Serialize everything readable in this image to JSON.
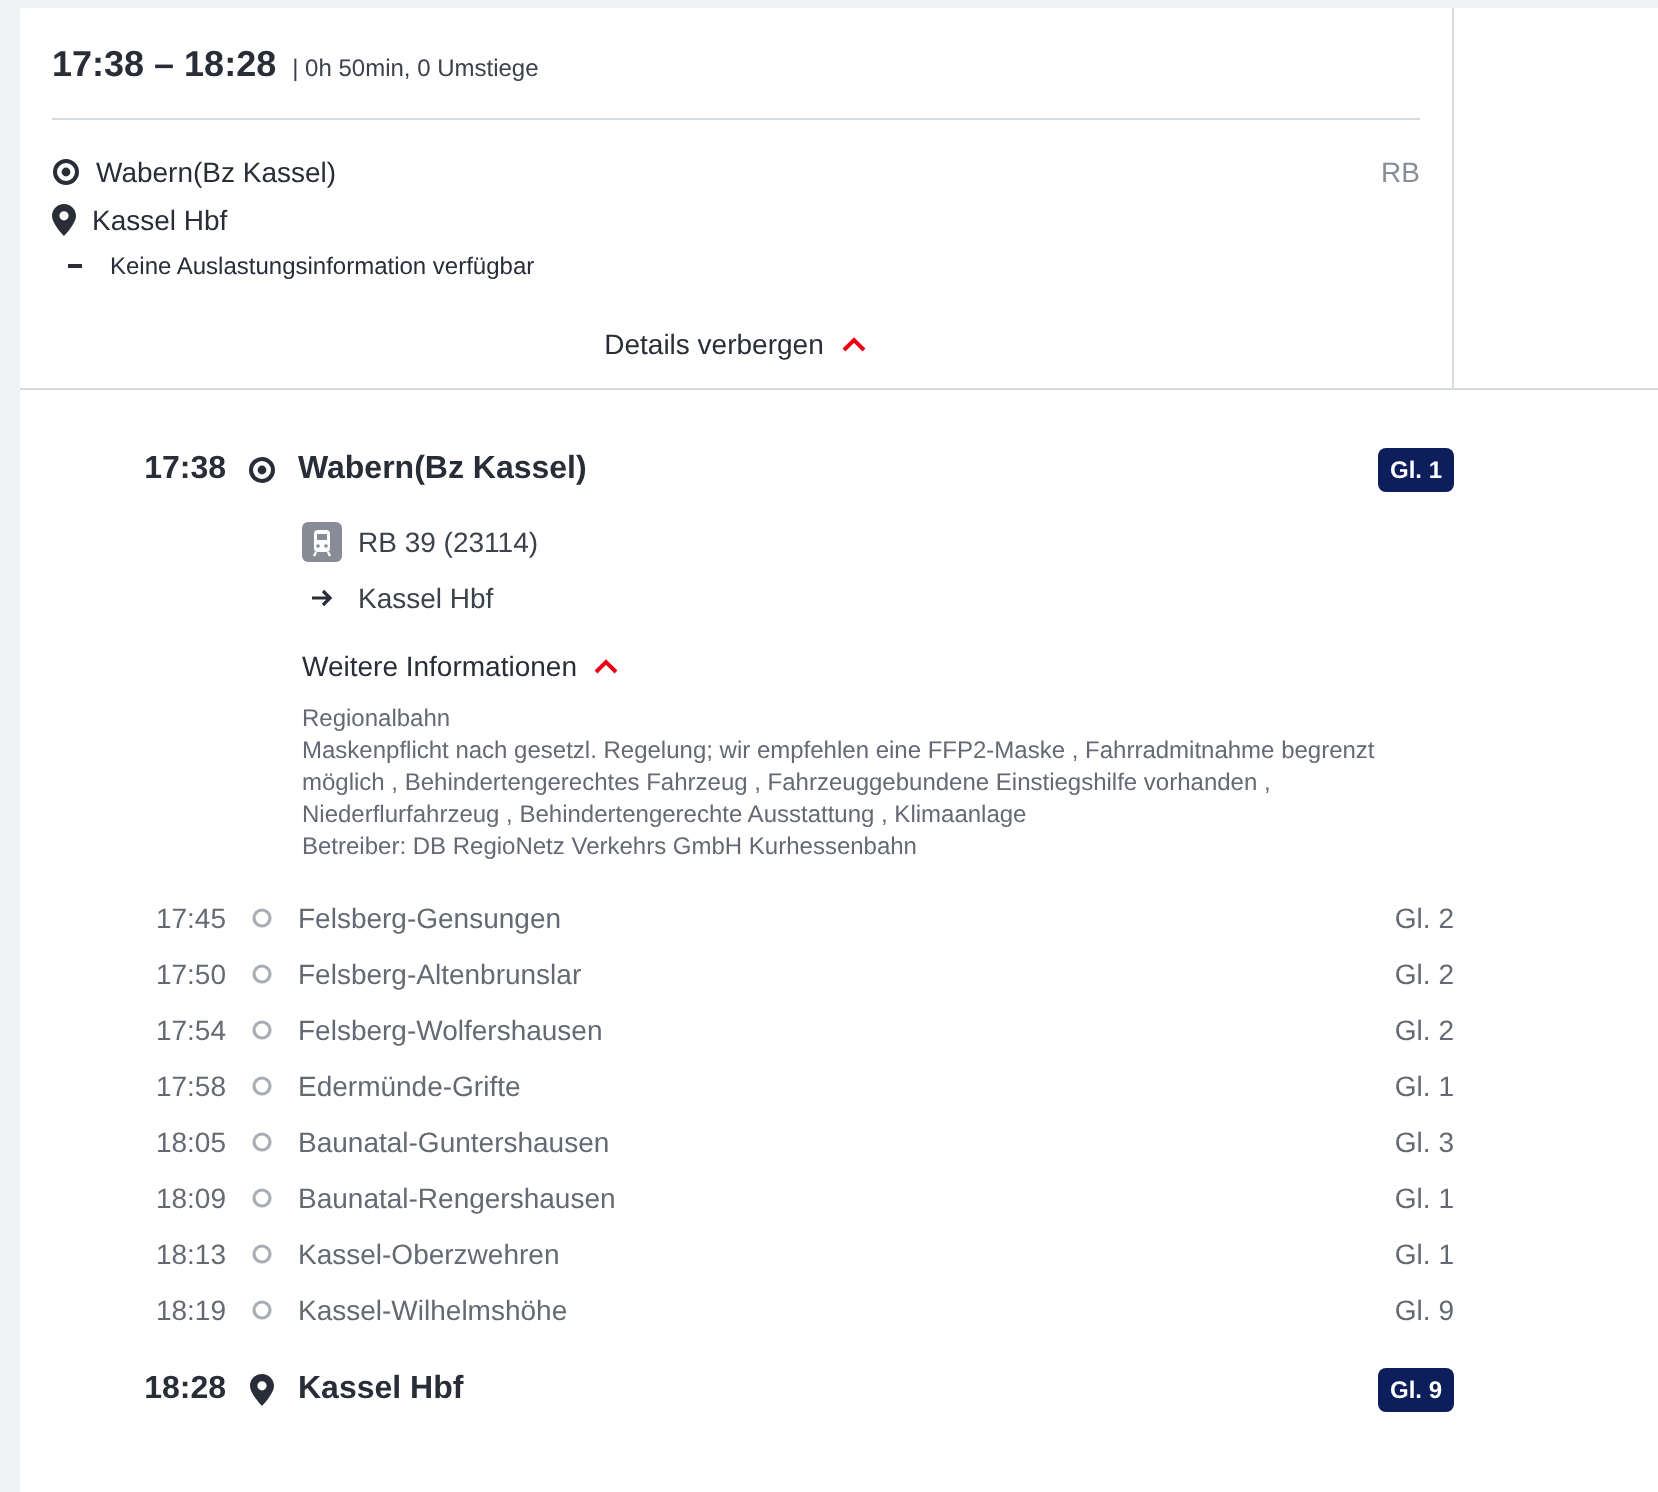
{
  "summary": {
    "time_range": "17:38 – 18:28",
    "duration": "| 0h 50min, 0 Umstiege",
    "origin": "Wabern(Bz Kassel)",
    "destination": "Kassel Hbf",
    "product": "RB",
    "occupancy": "Keine Auslastungsinformation verfügbar",
    "toggle": {
      "label": "Details verbergen",
      "expanded": true
    }
  },
  "journey": {
    "departure": {
      "time": "17:38",
      "station": "Wabern(Bz Kassel)",
      "platform": "Gl. 1"
    },
    "train": "RB 39 (23114)",
    "direction": "Kassel Hbf",
    "more_info": {
      "label": "Weitere Informationen",
      "expanded": true
    },
    "info_lines": [
      "Regionalbahn",
      "Maskenpflicht nach gesetzl. Regelung; wir empfehlen eine FFP2-Maske , Fahrradmitnahme begrenzt möglich , Behindertengerechtes Fahrzeug , Fahrzeuggebundene Einstiegshilfe vorhanden , Niederflurfahrzeug , Behindertengerechte Ausstattung , Klimaanlage",
      "Betreiber: DB RegioNetz Verkehrs GmbH Kurhessenbahn"
    ],
    "stops": [
      {
        "time": "17:45",
        "station": "Felsberg-Gensungen",
        "platform": "Gl. 2"
      },
      {
        "time": "17:50",
        "station": "Felsberg-Altenbrunslar",
        "platform": "Gl. 2"
      },
      {
        "time": "17:54",
        "station": "Felsberg-Wolfershausen",
        "platform": "Gl. 2"
      },
      {
        "time": "17:58",
        "station": "Edermünde-Grifte",
        "platform": "Gl. 1"
      },
      {
        "time": "18:05",
        "station": "Baunatal-Guntershausen",
        "platform": "Gl. 3"
      },
      {
        "time": "18:09",
        "station": "Baunatal-Rengershausen",
        "platform": "Gl. 1"
      },
      {
        "time": "18:13",
        "station": "Kassel-Oberzwehren",
        "platform": "Gl. 1"
      },
      {
        "time": "18:19",
        "station": "Kassel-Wilhelmshöhe",
        "platform": "Gl. 9"
      }
    ],
    "arrival": {
      "time": "18:28",
      "station": "Kassel Hbf",
      "platform": "Gl. 9"
    }
  }
}
